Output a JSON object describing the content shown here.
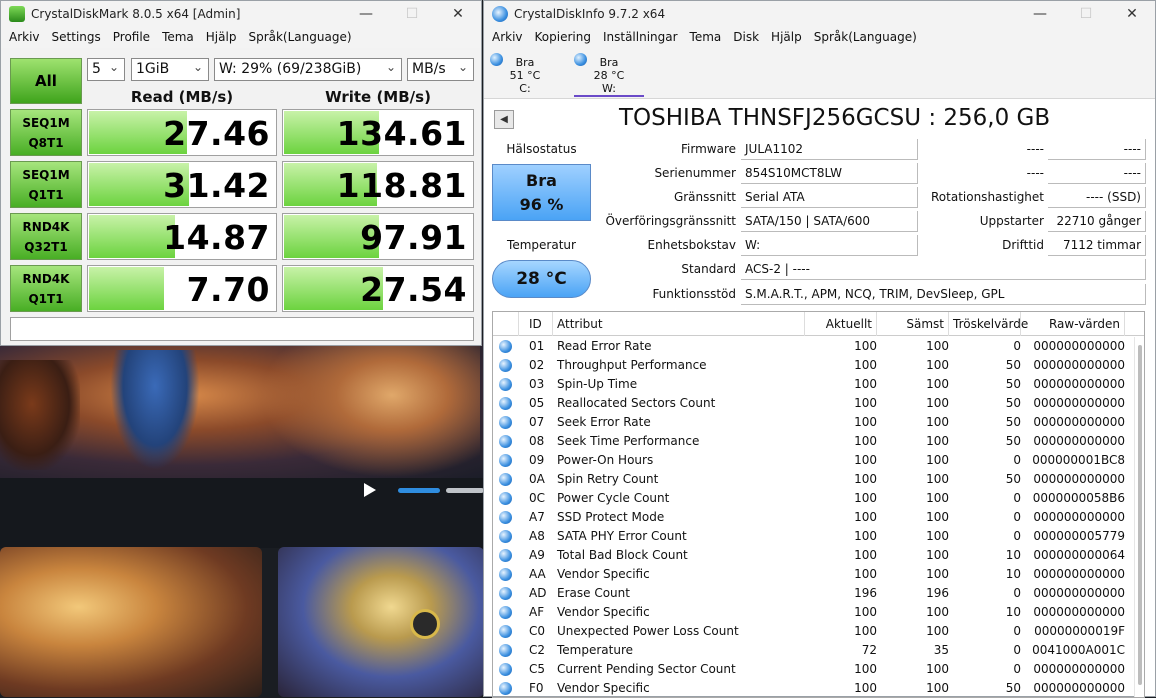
{
  "cdm": {
    "title": "CrystalDiskMark 8.0.5 x64 [Admin]",
    "menu": [
      "Arkiv",
      "Settings",
      "Profile",
      "Tema",
      "Hjälp",
      "Språk(Language)"
    ],
    "all_button": "All",
    "count": "5",
    "size": "1GiB",
    "drive": "W: 29% (69/238GiB)",
    "unit": "MB/s",
    "read_header": "Read (MB/s)",
    "write_header": "Write (MB/s)",
    "tests": [
      {
        "line1": "SEQ1M",
        "line2": "Q8T1",
        "read": "27.46",
        "write": "134.61",
        "read_fill": 0.52,
        "write_fill": 0.5
      },
      {
        "line1": "SEQ1M",
        "line2": "Q1T1",
        "read": "31.42",
        "write": "118.81",
        "read_fill": 0.53,
        "write_fill": 0.49
      },
      {
        "line1": "RND4K",
        "line2": "Q32T1",
        "read": "14.87",
        "write": "97.91",
        "read_fill": 0.46,
        "write_fill": 0.5
      },
      {
        "line1": "RND4K",
        "line2": "Q1T1",
        "read": "7.70",
        "write": "27.54",
        "read_fill": 0.4,
        "write_fill": 0.52
      }
    ]
  },
  "cdi": {
    "title": "CrystalDiskInfo 9.7.2 x64",
    "menu": [
      "Arkiv",
      "Kopiering",
      "Inställningar",
      "Tema",
      "Disk",
      "Hjälp",
      "Språk(Language)"
    ],
    "drives": [
      {
        "status": "Bra",
        "temp": "51 °C",
        "letter": "C:"
      },
      {
        "status": "Bra",
        "temp": "28 °C",
        "letter": "W:"
      }
    ],
    "model": "TOSHIBA THNSFJ256GCSU : 256,0 GB",
    "health_label": "Hälsostatus",
    "health_status": "Bra",
    "health_percent": "96 %",
    "temp_label": "Temperatur",
    "temp_value": "28 °C",
    "fields": {
      "firmware_label": "Firmware",
      "firmware": "JULA1102",
      "serial_label": "Serienummer",
      "serial": "854S10MCT8LW",
      "interface_label": "Gränssnitt",
      "interface": "Serial ATA",
      "transfer_label": "Överföringsgränssnitt",
      "transfer": "SATA/150 | SATA/600",
      "driveletter_label": "Enhetsbokstav",
      "driveletter": "W:",
      "standard_label": "Standard",
      "standard": "ACS-2 | ----",
      "features_label": "Funktionsstöd",
      "features": "S.M.A.R.T., APM, NCQ, TRIM, DevSleep, GPL",
      "r1_label": "----",
      "r1_value": "----",
      "r2_label": "----",
      "r2_value": "----",
      "rotation_label": "Rotationshastighet",
      "rotation": "---- (SSD)",
      "powercount_label": "Uppstarter",
      "powercount": "22710 gånger",
      "hours_label": "Drifttid",
      "hours": "7112 timmar"
    },
    "table_headers": [
      "ID",
      "Attribut",
      "Aktuellt",
      "Sämst",
      "Tröskelvärde",
      "Raw-värden"
    ],
    "rows": [
      {
        "id": "01",
        "name": "Read Error Rate",
        "cur": "100",
        "worst": "100",
        "thr": "0",
        "raw": "000000000000"
      },
      {
        "id": "02",
        "name": "Throughput Performance",
        "cur": "100",
        "worst": "100",
        "thr": "50",
        "raw": "000000000000"
      },
      {
        "id": "03",
        "name": "Spin-Up Time",
        "cur": "100",
        "worst": "100",
        "thr": "50",
        "raw": "000000000000"
      },
      {
        "id": "05",
        "name": "Reallocated Sectors Count",
        "cur": "100",
        "worst": "100",
        "thr": "50",
        "raw": "000000000000"
      },
      {
        "id": "07",
        "name": "Seek Error Rate",
        "cur": "100",
        "worst": "100",
        "thr": "50",
        "raw": "000000000000"
      },
      {
        "id": "08",
        "name": "Seek Time Performance",
        "cur": "100",
        "worst": "100",
        "thr": "50",
        "raw": "000000000000"
      },
      {
        "id": "09",
        "name": "Power-On Hours",
        "cur": "100",
        "worst": "100",
        "thr": "0",
        "raw": "000000001BC8"
      },
      {
        "id": "0A",
        "name": "Spin Retry Count",
        "cur": "100",
        "worst": "100",
        "thr": "50",
        "raw": "000000000000"
      },
      {
        "id": "0C",
        "name": "Power Cycle Count",
        "cur": "100",
        "worst": "100",
        "thr": "0",
        "raw": "0000000058B6"
      },
      {
        "id": "A7",
        "name": "SSD Protect Mode",
        "cur": "100",
        "worst": "100",
        "thr": "0",
        "raw": "000000000000"
      },
      {
        "id": "A8",
        "name": "SATA PHY Error Count",
        "cur": "100",
        "worst": "100",
        "thr": "0",
        "raw": "000000005779"
      },
      {
        "id": "A9",
        "name": "Total Bad Block Count",
        "cur": "100",
        "worst": "100",
        "thr": "10",
        "raw": "000000000064"
      },
      {
        "id": "AA",
        "name": "Vendor Specific",
        "cur": "100",
        "worst": "100",
        "thr": "10",
        "raw": "000000000000"
      },
      {
        "id": "AD",
        "name": "Erase Count",
        "cur": "196",
        "worst": "196",
        "thr": "0",
        "raw": "000000000000"
      },
      {
        "id": "AF",
        "name": "Vendor Specific",
        "cur": "100",
        "worst": "100",
        "thr": "10",
        "raw": "000000000000"
      },
      {
        "id": "C0",
        "name": "Unexpected Power Loss Count",
        "cur": "100",
        "worst": "100",
        "thr": "0",
        "raw": "00000000019F"
      },
      {
        "id": "C2",
        "name": "Temperature",
        "cur": "72",
        "worst": "35",
        "thr": "0",
        "raw": "0041000A001C"
      },
      {
        "id": "C5",
        "name": "Current Pending Sector Count",
        "cur": "100",
        "worst": "100",
        "thr": "0",
        "raw": "000000000000"
      },
      {
        "id": "F0",
        "name": "Vendor Specific",
        "cur": "100",
        "worst": "100",
        "thr": "50",
        "raw": "000000000000"
      }
    ]
  }
}
